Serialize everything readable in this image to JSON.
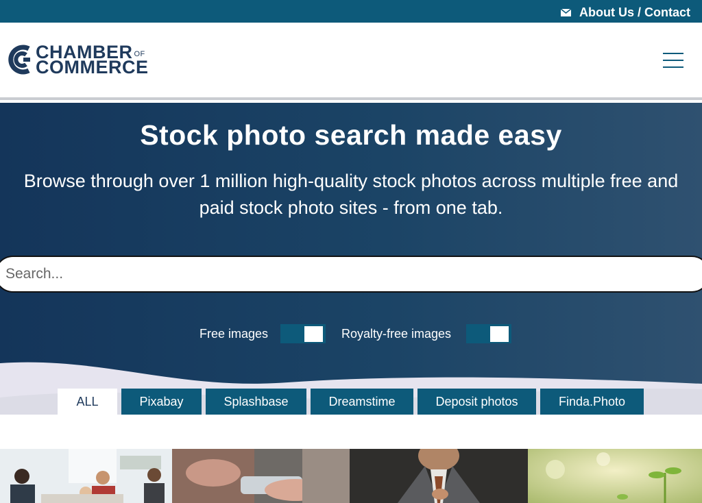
{
  "topbar": {
    "contact_link": "About Us / Contact",
    "icon": "envelope-icon"
  },
  "header": {
    "logo": {
      "line1": "CHAMBER",
      "of": "OF",
      "line2": "COMMERCE"
    },
    "menu_icon": "hamburger-icon"
  },
  "hero": {
    "title": "Stock photo search made easy",
    "subtitle_line1": "Browse through over 1 million high-quality stock photos across multiple free and",
    "subtitle_line2": "paid stock photo sites - from one tab.",
    "search_placeholder": "Search...",
    "toggles": [
      {
        "label": "Free images",
        "on": true
      },
      {
        "label": "Royalty-free images",
        "on": true
      }
    ]
  },
  "tabs": [
    {
      "label": "ALL",
      "active": true
    },
    {
      "label": "Pixabay",
      "active": false
    },
    {
      "label": "Splashbase",
      "active": false
    },
    {
      "label": "Dreamstime",
      "active": false
    },
    {
      "label": "Deposit photos",
      "active": false
    },
    {
      "label": "Finda.Photo",
      "active": false
    }
  ],
  "colors": {
    "brand_teal": "#0d5a7a",
    "brand_navy": "#1f3a5c",
    "hero_dark": "#14355a"
  }
}
